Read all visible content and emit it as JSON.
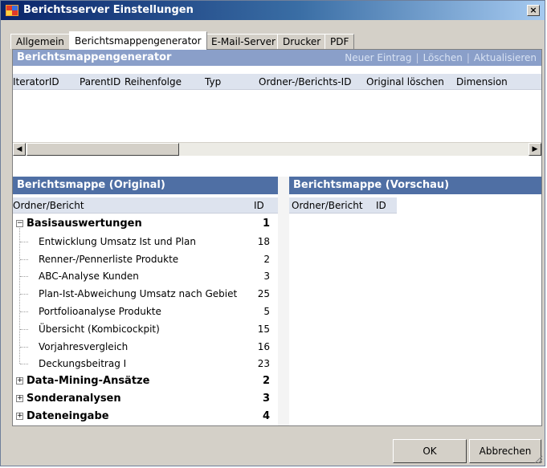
{
  "window": {
    "title": "Berichtsserver Einstellungen",
    "close_label": "×"
  },
  "tabs": [
    "Allgemein",
    "Berichtsmappengenerator",
    "E-Mail-Server",
    "Drucker",
    "PDF"
  ],
  "generator": {
    "title": "Berichtsmappengenerator",
    "links": [
      "Neuer Eintrag",
      "Löschen",
      "Aktualisieren"
    ],
    "columns": [
      "IteratorID",
      "ParentID",
      "Reihenfolge",
      "Typ",
      "Ordner-/Berichts-ID",
      "Original löschen",
      "Dimension"
    ]
  },
  "original": {
    "title": "Berichtsmappe (Original)",
    "col_name": "Ordner/Bericht",
    "col_id": "ID",
    "rows": [
      {
        "label": "Basisauswertungen",
        "id": "1",
        "level": 0,
        "expander": "−"
      },
      {
        "label": "Entwicklung Umsatz Ist und Plan",
        "id": "18",
        "level": 1
      },
      {
        "label": "Renner-/Pennerliste Produkte",
        "id": "2",
        "level": 1
      },
      {
        "label": "ABC-Analyse Kunden",
        "id": "3",
        "level": 1
      },
      {
        "label": "Plan-Ist-Abweichung Umsatz nach Gebiet",
        "id": "25",
        "level": 1
      },
      {
        "label": "Portfolioanalyse Produkte",
        "id": "5",
        "level": 1
      },
      {
        "label": "Übersicht (Kombicockpit)",
        "id": "15",
        "level": 1
      },
      {
        "label": "Vorjahresvergleich",
        "id": "16",
        "level": 1
      },
      {
        "label": "Deckungsbeitrag I",
        "id": "23",
        "level": 1
      },
      {
        "label": "Data-Mining-Ansätze",
        "id": "2",
        "level": 0,
        "expander": "+"
      },
      {
        "label": "Sonderanalysen",
        "id": "3",
        "level": 0,
        "expander": "+"
      },
      {
        "label": "Dateneingabe",
        "id": "4",
        "level": 0,
        "expander": "+"
      }
    ]
  },
  "preview": {
    "title": "Berichtsmappe (Vorschau)",
    "col_name": "Ordner/Bericht",
    "col_id": "ID"
  },
  "buttons": {
    "ok": "OK",
    "cancel": "Abbrechen"
  }
}
